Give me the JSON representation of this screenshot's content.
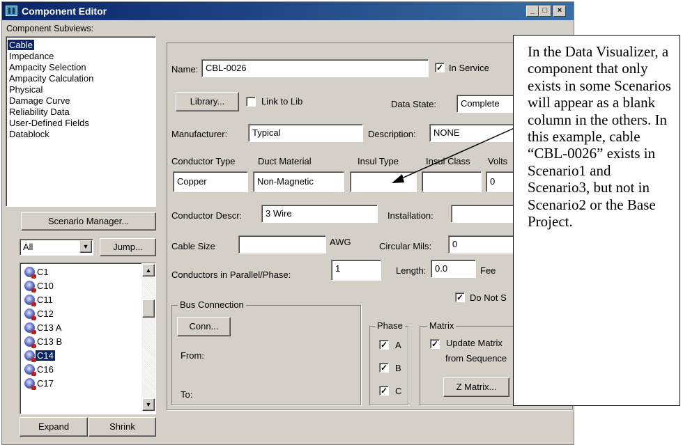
{
  "window": {
    "title": "Component Editor",
    "controls": {
      "minimize": "_",
      "maximize": "□",
      "close": "×"
    }
  },
  "subviews": {
    "label": "Component Subviews:",
    "items": [
      "Cable",
      "Impedance",
      "Ampacity Selection",
      "Ampacity Calculation",
      "Physical",
      "Damage Curve",
      "Reliability Data",
      "User-Defined Fields",
      "Datablock"
    ],
    "selected": "Cable"
  },
  "scenario_manager_label": "Scenario Manager...",
  "filter": {
    "value": "All",
    "jump_label": "Jump..."
  },
  "components": {
    "items": [
      "C1",
      "C10",
      "C11",
      "C12",
      "C13 A",
      "C13 B",
      "C14",
      "C16",
      "C17"
    ],
    "selected": "C14"
  },
  "expand_label": "Expand",
  "shrink_label": "Shrink",
  "form": {
    "name_label": "Name:",
    "name_value": "CBL-0026",
    "in_service_label": "In Service",
    "in_service_checked": true,
    "library_label": "Library...",
    "link_to_lib_label": "Link to Lib",
    "link_to_lib_checked": false,
    "data_state_label": "Data State:",
    "data_state_value": "Complete",
    "manufacturer_label": "Manufacturer:",
    "manufacturer_value": "Typical",
    "description_label": "Description:",
    "description_value": "NONE",
    "conductor_type_label": "Conductor Type",
    "duct_material_label": "Duct Material",
    "insul_type_label": "Insul Type",
    "insul_class_label": "Insul Class",
    "volts_label": "Volts",
    "conductor_type_value": "Copper",
    "duct_material_value": "Non-Magnetic",
    "insul_type_value": "",
    "insul_class_value": "",
    "volts_value": "0",
    "conductor_descr_label": "Conductor Descr:",
    "conductor_descr_value": "3 Wire",
    "installation_label": "Installation:",
    "installation_value": "",
    "cable_size_label": "Cable Size",
    "cable_size_value": "",
    "awg_label": "AWG",
    "circular_mils_label": "Circular Mils:",
    "circular_mils_value": "0",
    "conductors_parallel_label": "Conductors in Parallel/Phase:",
    "conductors_parallel_value": "1",
    "length_label": "Length:",
    "length_value": "0.0",
    "length_unit": "Fee",
    "do_not_label": "Do Not S",
    "do_not_checked": true,
    "bus_connection_label": "Bus Connection",
    "conn_label": "Conn...",
    "from_label": "From:",
    "to_label": "To:",
    "phase_label": "Phase",
    "phases": [
      {
        "label": "A",
        "checked": true
      },
      {
        "label": "B",
        "checked": true
      },
      {
        "label": "C",
        "checked": true
      }
    ],
    "matrix_label": "Matrix",
    "update_matrix_line1": "Update Matrix",
    "update_matrix_line2": "from Sequence",
    "update_matrix_checked": true,
    "z_matrix_label": "Z Matrix..."
  },
  "callout": {
    "text": "In the Data Visualizer, a component that only exists in some Scenarios will appear as a blank column in the others. In this example, cable “CBL-0026” exists in Scenario1 and Scenario3, but not in Scenario2 or the Base Project."
  }
}
